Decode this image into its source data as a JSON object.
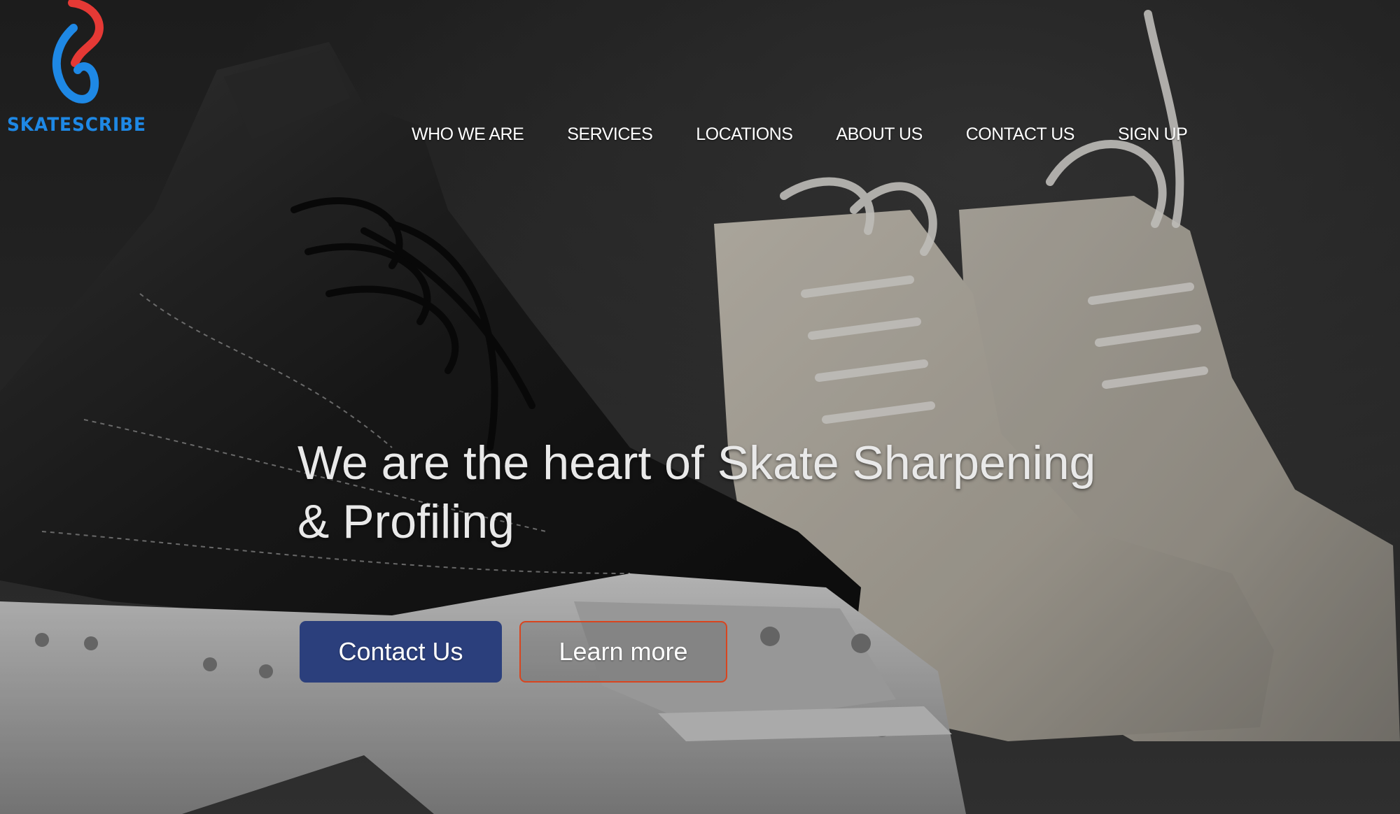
{
  "brand": {
    "name": "SKATESCRIBE",
    "colors": {
      "blue": "#1e88e5",
      "red": "#e53935"
    }
  },
  "nav": {
    "items": [
      {
        "label": "WHO WE ARE"
      },
      {
        "label": "SERVICES"
      },
      {
        "label": "LOCATIONS"
      },
      {
        "label": "ABOUT US"
      },
      {
        "label": "CONTACT US"
      },
      {
        "label": "SIGN UP"
      }
    ]
  },
  "hero": {
    "headline_line1": "We are the heart of Skate Sharpening",
    "headline_line2": "& Profiling",
    "background_icon": "ice-skates-photo"
  },
  "buttons": {
    "contact_label": "Contact Us",
    "learn_label": "Learn more",
    "contact_color": "#2b3f7c",
    "learn_border_color": "#d8451f"
  }
}
